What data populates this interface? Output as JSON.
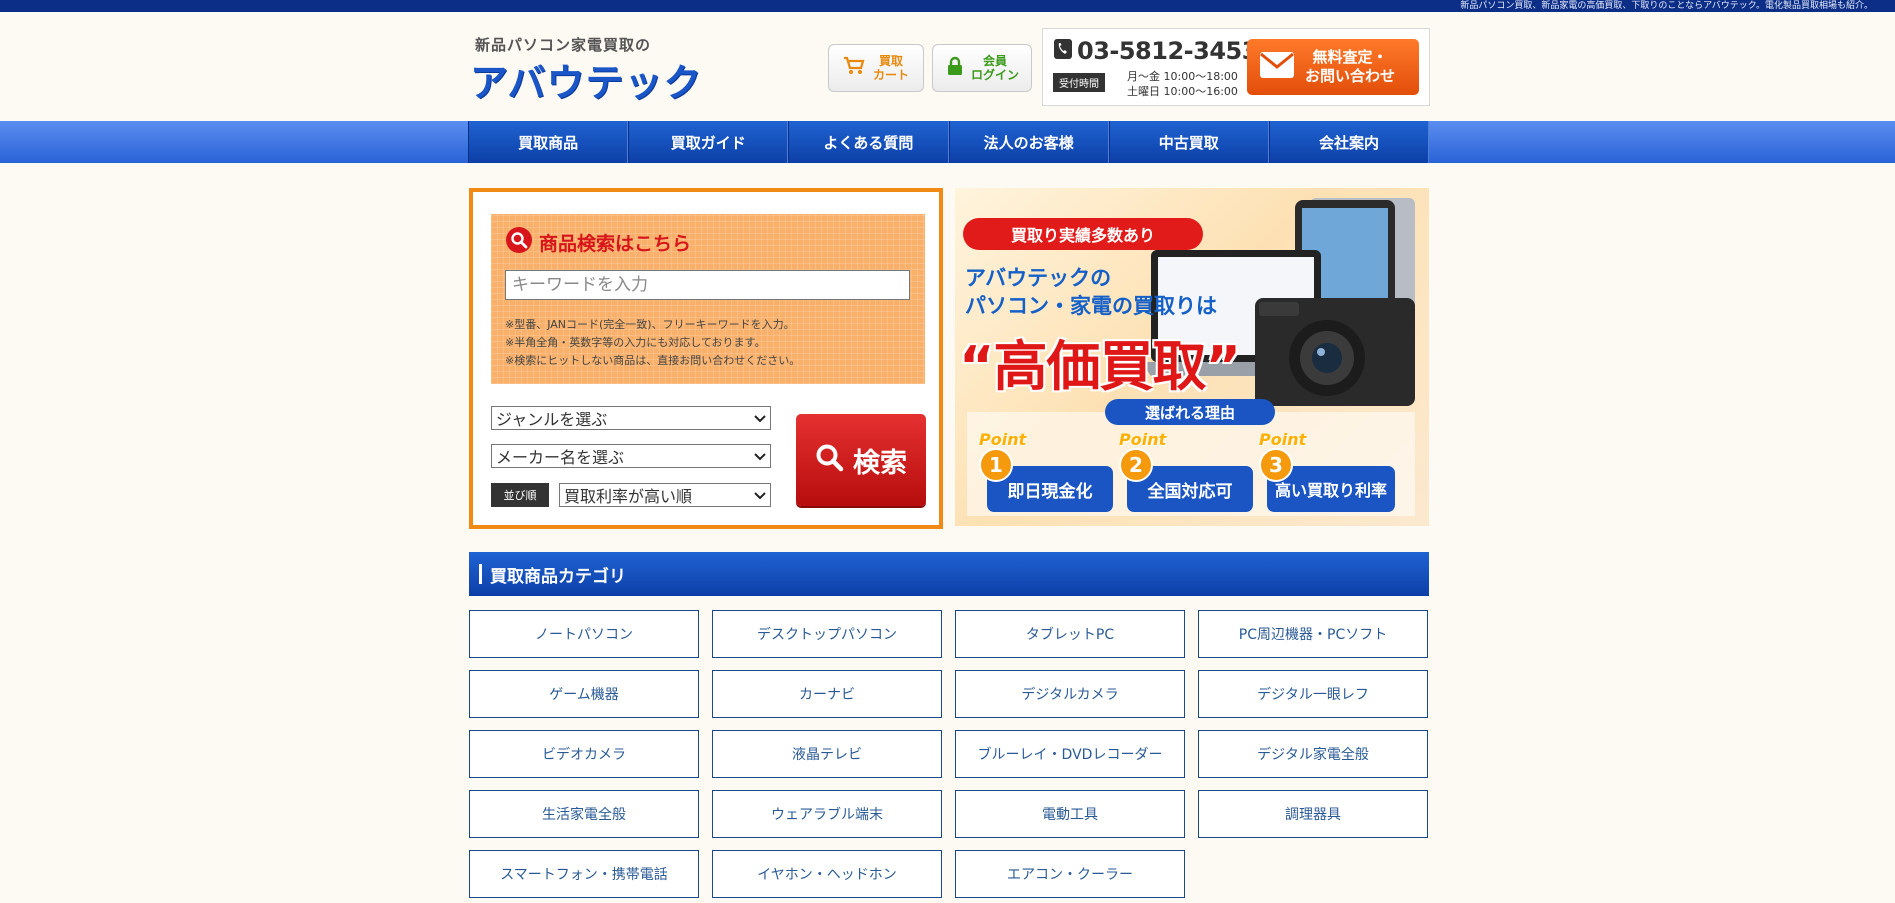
{
  "topbar": {
    "text": "新品パソコン買取、新品家電の高価買取、下取りのことならアバウテック。電化製品買取相場も紹介。"
  },
  "logo": {
    "sub": "新品パソコン家電買取の",
    "main": "アバウテック"
  },
  "header": {
    "cart_line1": "買取",
    "cart_line2": "カート",
    "login_line1": "会員",
    "login_line2": "ログイン",
    "phone": "03-5812-3453",
    "hours_label": "受付時間",
    "hours_weekday": "月〜金 10:00〜18:00",
    "hours_saturday": "土曜日 10:00〜16:00",
    "inquiry_line1": "無料査定・",
    "inquiry_line2": "お問い合わせ"
  },
  "nav": [
    {
      "label": "買取商品"
    },
    {
      "label": "買取ガイド"
    },
    {
      "label": "よくある質問"
    },
    {
      "label": "法人のお客様"
    },
    {
      "label": "中古買取"
    },
    {
      "label": "会社案内"
    }
  ],
  "search": {
    "title": "商品検索はこちら",
    "placeholder": "キーワードを入力",
    "notes": [
      "※型番、JANコード(完全一致)、フリーキーワードを入力。",
      "※半角全角・英数字等の入力にも対応しております。",
      "※検索にヒットしない商品は、直接お問い合わせください。"
    ],
    "genre_selected": "ジャンルを選ぶ",
    "maker_selected": "メーカー名を選ぶ",
    "sort_label": "並び順",
    "sort_selected": "買取利率が高い順",
    "button_label": "検索"
  },
  "banner": {
    "pill": "買取り実績多数あり",
    "line1": "アバウテックの",
    "line2": "パソコン・家電の買取りは",
    "big": "“高価買取”",
    "reason": "選ばれる理由",
    "points": [
      {
        "pt": "Point",
        "num": "1",
        "label": "即日現金化"
      },
      {
        "pt": "Point",
        "num": "2",
        "label": "全国対応可"
      },
      {
        "pt": "Point",
        "num": "3",
        "label": "高い買取り利率"
      }
    ]
  },
  "categories": {
    "title": "買取商品カテゴリ",
    "items": [
      "ノートパソコン",
      "デスクトップパソコン",
      "タブレットPC",
      "PC周辺機器・PCソフト",
      "ゲーム機器",
      "カーナビ",
      "デジタルカメラ",
      "デジタル一眼レフ",
      "ビデオカメラ",
      "液晶テレビ",
      "ブルーレイ・DVDレコーダー",
      "デジタル家電全般",
      "生活家電全般",
      "ウェアラブル端末",
      "電動工具",
      "調理器具",
      "スマートフォン・携帯電話",
      "イヤホン・ヘッドホン",
      "エアコン・クーラー"
    ]
  },
  "colors": {
    "brand_blue": "#1a56c8",
    "accent_orange": "#f08a14",
    "search_red": "#d8151b",
    "nav_blue": "#0d3fa8"
  }
}
